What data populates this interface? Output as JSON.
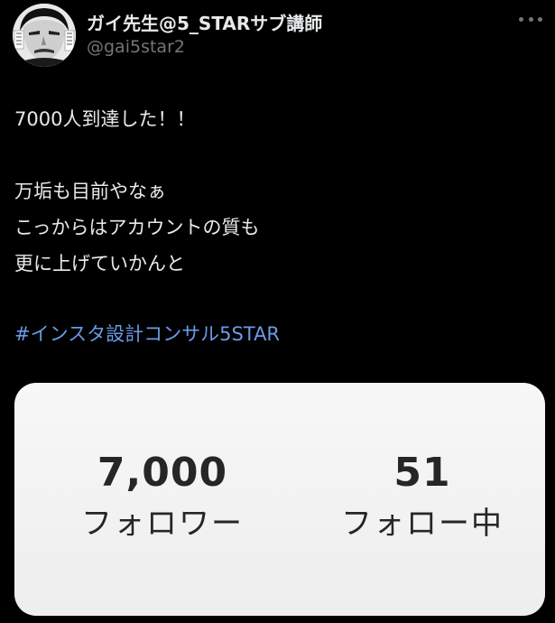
{
  "author": {
    "display_name": "ガイ先生@5_STARサブ講師",
    "handle": "@gai5star2",
    "avatar_icon": "manga-face-avatar"
  },
  "tweet": {
    "lines": [
      "7000人到達した！！",
      "",
      "万垢も目前やなぁ",
      "こっからはアカウントの質も",
      "更に上げていかんと"
    ],
    "hashtag": "#インスタ設計コンサル5STAR"
  },
  "media": {
    "followers": {
      "value": "7,000",
      "label": "フォロワー"
    },
    "following": {
      "value": "51",
      "label": "フォロー中"
    }
  },
  "colors": {
    "background": "#000000",
    "text": "#e7e9ea",
    "secondary_text": "#71767b",
    "link": "#6a9be8",
    "card": "#f2f2f2",
    "card_text": "#262626"
  },
  "icons": {
    "more": "more-horizontal-icon"
  }
}
